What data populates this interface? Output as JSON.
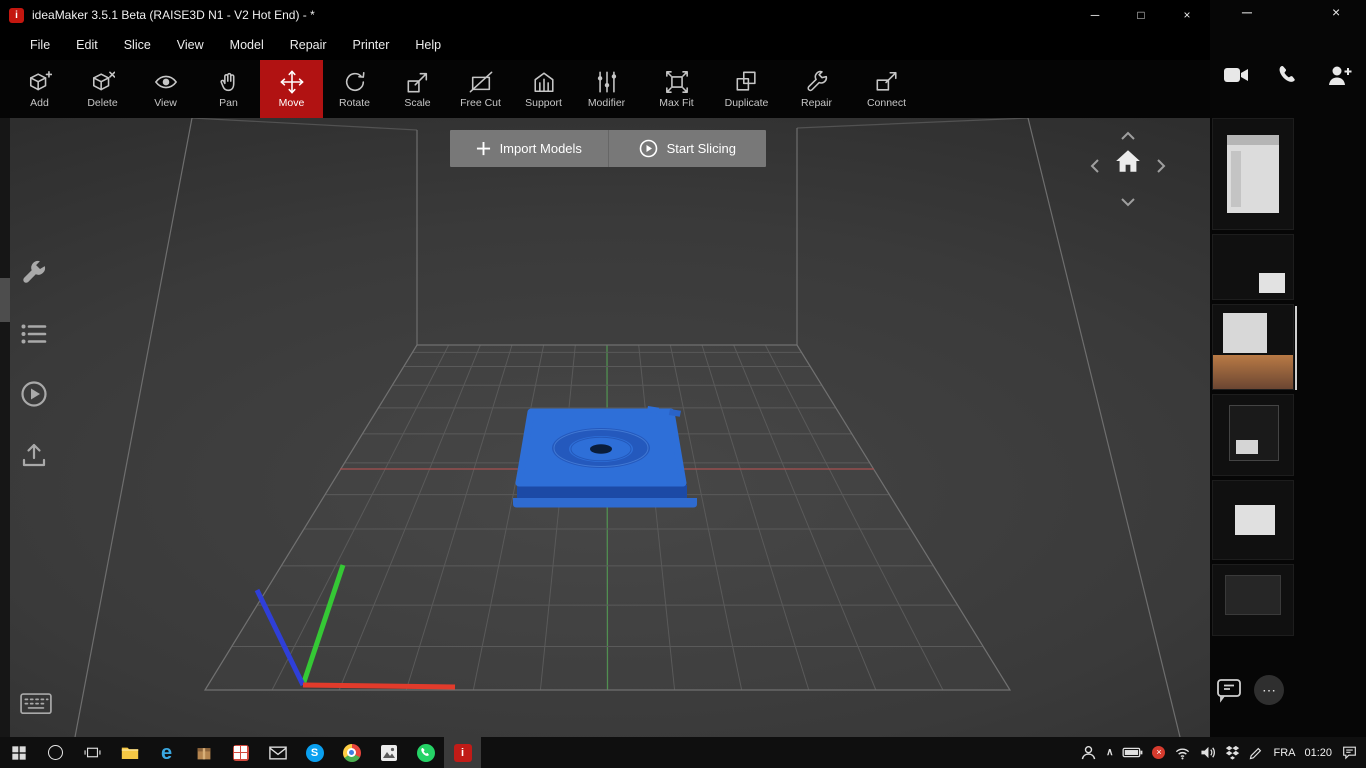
{
  "titlebar": {
    "title": "ideaMaker 3.5.1 Beta (RAISE3D N1 - V2 Hot End) - *",
    "app_logo_letter": "i",
    "controls": {
      "minimize": "─",
      "maximize": "□",
      "close": "×"
    }
  },
  "menu": {
    "items": [
      "File",
      "Edit",
      "Slice",
      "View",
      "Model",
      "Repair",
      "Printer",
      "Help"
    ]
  },
  "toolbar": {
    "active_index": 4,
    "active_color": "#b11212",
    "items": [
      {
        "label": "Add",
        "icon": "add-cube-icon"
      },
      {
        "label": "Delete",
        "icon": "delete-cube-icon"
      },
      {
        "label": "View",
        "icon": "eye-icon"
      },
      {
        "label": "Pan",
        "icon": "hand-icon"
      },
      {
        "label": "Move",
        "icon": "move-arrows-icon"
      },
      {
        "label": "Rotate",
        "icon": "rotate-icon"
      },
      {
        "label": "Scale",
        "icon": "scale-icon"
      },
      {
        "label": "Free Cut",
        "icon": "free-cut-icon"
      },
      {
        "label": "Support",
        "icon": "support-icon"
      },
      {
        "label": "Modifier",
        "icon": "modifier-sliders-icon"
      },
      {
        "label": "Max Fit",
        "icon": "max-fit-icon"
      },
      {
        "label": "Duplicate",
        "icon": "duplicate-icon"
      },
      {
        "label": "Repair",
        "icon": "repair-wrench-icon"
      },
      {
        "label": "Connect",
        "icon": "connect-icon"
      }
    ]
  },
  "viewport": {
    "import_button": "Import Models",
    "slice_button": "Start Slicing",
    "model_color": "#2e6fd8",
    "axis_colors": {
      "x": "#e23b2b",
      "y": "#35c835",
      "z": "#2f3fd8"
    }
  },
  "sidebar": {
    "icons": [
      "wrench-icon",
      "list-icon",
      "play-circle-icon",
      "upload-icon",
      "keyboard-icon"
    ]
  },
  "nav_widget": {
    "icons": [
      "chevron-up-icon",
      "chevron-left-icon",
      "home-icon",
      "chevron-right-icon",
      "chevron-down-icon"
    ]
  },
  "right_panel": {
    "controls": {
      "minimize": "─",
      "close": "×"
    },
    "action_icons": [
      "video-camera-icon",
      "phone-icon",
      "add-person-icon"
    ],
    "thumbnails_count": 6,
    "ellipsis": "⋯"
  },
  "taskbar": {
    "language": "FRA",
    "time": "01:20",
    "apps": [
      "start",
      "search",
      "task-view",
      "file-explorer",
      "edge",
      "package",
      "red-app",
      "mail",
      "skype",
      "chrome",
      "photos",
      "whatsapp",
      "ideamaker"
    ],
    "active_app": "ideamaker"
  }
}
